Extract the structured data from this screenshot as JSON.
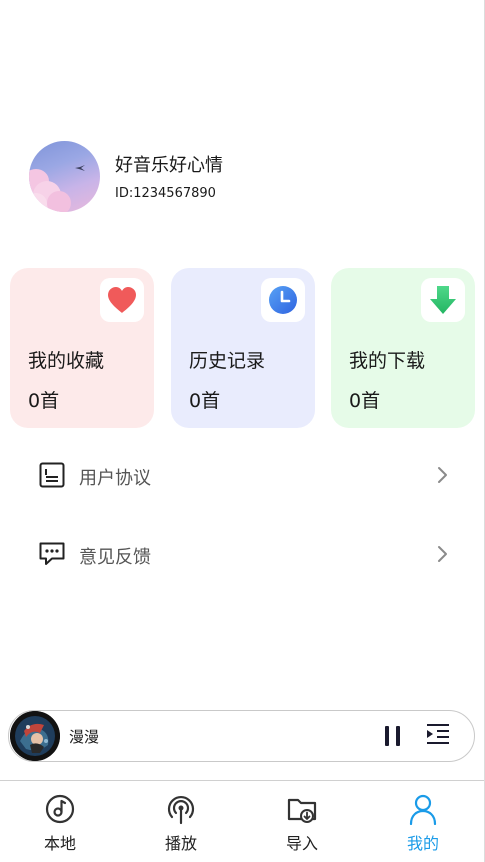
{
  "profile": {
    "nickname": "好音乐好心情",
    "user_id": "ID:1234567890"
  },
  "cards": [
    {
      "title": "我的收藏",
      "count": "0首",
      "icon": "heart-icon",
      "bg": "#fdeaea",
      "accent": "#f05a5a"
    },
    {
      "title": "历史记录",
      "count": "0首",
      "icon": "clock-icon",
      "bg": "#e9ecfd",
      "accent": "#3a7bea"
    },
    {
      "title": "我的下载",
      "count": "0首",
      "icon": "download-arrow-icon",
      "bg": "#e6fbe8",
      "accent": "#35c872"
    }
  ],
  "menu": [
    {
      "label": "用户协议",
      "icon": "document-icon"
    },
    {
      "label": "意见反馈",
      "icon": "feedback-chat-icon"
    }
  ],
  "player": {
    "track_title": "漫漫",
    "state": "playing"
  },
  "nav": {
    "items": [
      {
        "label": "本地",
        "icon": "music-disc-icon"
      },
      {
        "label": "播放",
        "icon": "broadcast-icon"
      },
      {
        "label": "导入",
        "icon": "folder-import-icon"
      },
      {
        "label": "我的",
        "icon": "user-icon"
      }
    ],
    "active_index": 3,
    "active_color": "#1a9be8"
  }
}
